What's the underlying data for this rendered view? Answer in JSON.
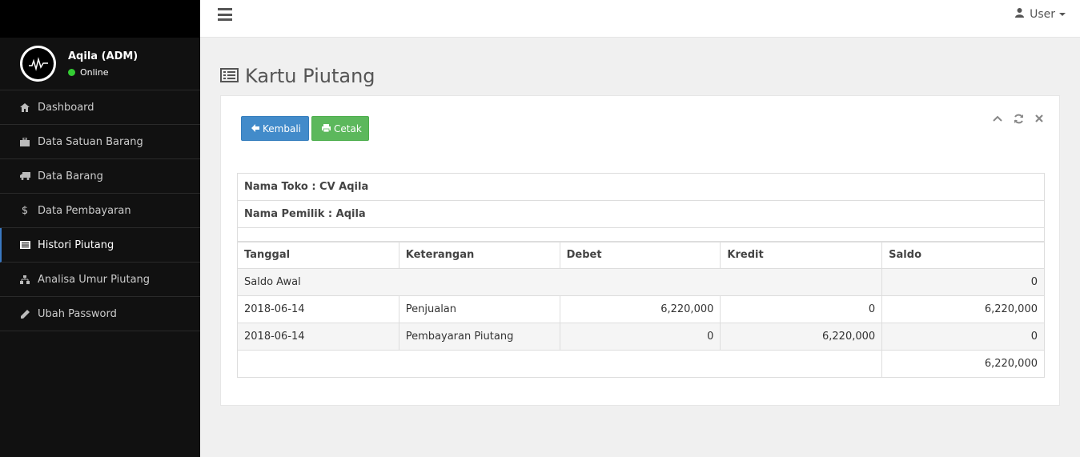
{
  "sidebar": {
    "profile": {
      "name": "Aqila (ADM)",
      "status": "Online"
    },
    "items": [
      {
        "label": "Dashboard",
        "icon": "home-icon"
      },
      {
        "label": "Data Satuan Barang",
        "icon": "briefcase-icon"
      },
      {
        "label": "Data Barang",
        "icon": "truck-icon"
      },
      {
        "label": "Data Pembayaran",
        "icon": "dollar-icon"
      },
      {
        "label": "Histori Piutang",
        "icon": "list-alt-icon",
        "active": true
      },
      {
        "label": "Analisa Umur Piutang",
        "icon": "sitemap-icon"
      },
      {
        "label": "Ubah Password",
        "icon": "pencil-icon"
      }
    ]
  },
  "topbar": {
    "user_label": "User"
  },
  "page": {
    "title": "Kartu Piutang"
  },
  "toolbar": {
    "back_label": "Kembali",
    "print_label": "Cetak"
  },
  "info": {
    "toko": "Nama Toko : CV Aqila",
    "pemilik": "Nama Pemilik : Aqila"
  },
  "table": {
    "headers": [
      "Tanggal",
      "Keterangan",
      "Debet",
      "Kredit",
      "Saldo"
    ],
    "saldo_awal_label": "Saldo Awal",
    "saldo_awal_value": "0",
    "rows": [
      {
        "tanggal": "2018-06-14",
        "keterangan": "Penjualan",
        "debet": "6,220,000",
        "kredit": "0",
        "saldo": "6,220,000"
      },
      {
        "tanggal": "2018-06-14",
        "keterangan": "Pembayaran Piutang",
        "debet": "0",
        "kredit": "6,220,000",
        "saldo": "0"
      }
    ],
    "total": "6,220,000"
  },
  "colors": {
    "accent": "#428bca",
    "success": "#5cb85c",
    "sidebar_bg": "#111111",
    "online": "#33cc33"
  }
}
